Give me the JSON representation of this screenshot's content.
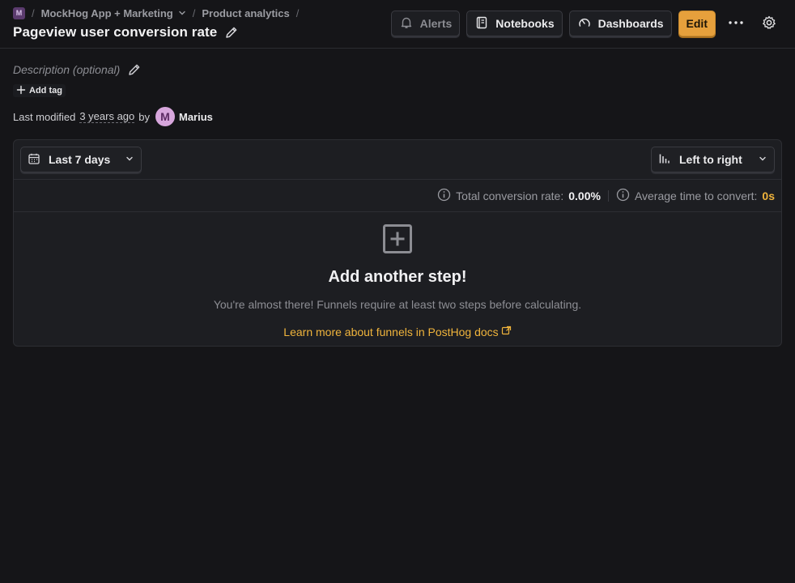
{
  "breadcrumb": {
    "project_avatar": "M",
    "project": "MockHog App + Marketing",
    "section": "Product analytics",
    "separator": "/"
  },
  "header": {
    "title": "Pageview user conversion rate"
  },
  "actions": {
    "alerts": "Alerts",
    "notebooks": "Notebooks",
    "dashboards": "Dashboards",
    "edit": "Edit"
  },
  "meta": {
    "description_placeholder": "Description (optional)",
    "add_tag": "Add tag",
    "modified_prefix": "Last modified",
    "modified_time": "3 years ago",
    "by": "by",
    "user_initial": "M",
    "user_name": "Marius"
  },
  "filters": {
    "date_range": "Last 7 days",
    "layout": "Left to right"
  },
  "stats": {
    "conversion_label": "Total conversion rate:",
    "conversion_value": "0.00%",
    "time_label": "Average time to convert:",
    "time_value": "0s"
  },
  "empty_state": {
    "title": "Add another step!",
    "subtitle": "You're almost there! Funnels require at least two steps before calculating.",
    "link": "Learn more about funnels in PostHog docs"
  },
  "colors": {
    "accent": "#f0b43c",
    "primary_button": "#e6a03c",
    "background": "#151518",
    "panel": "#1d1e22"
  }
}
